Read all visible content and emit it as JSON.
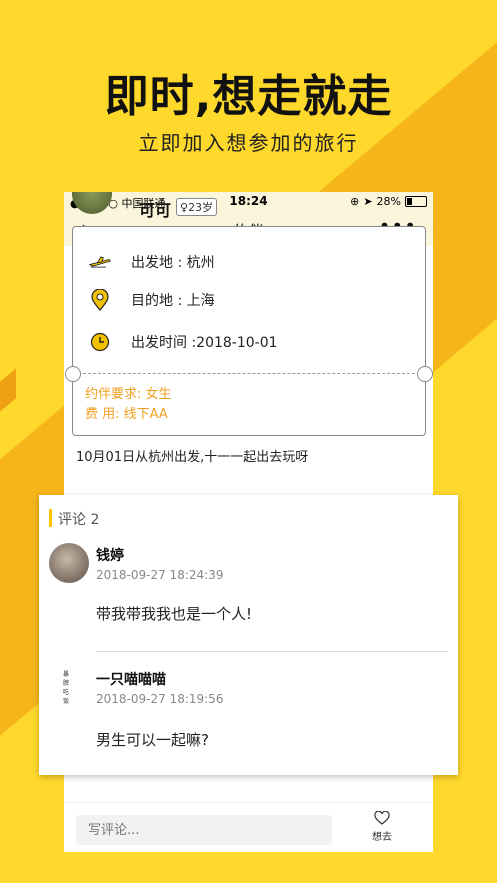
{
  "promo": {
    "headline": "即时,想走就走",
    "subline": "立即加入想参加的旅行"
  },
  "status_bar": {
    "carrier": "●●●●○ 中国联通",
    "time": "18:24",
    "battery": "28%"
  },
  "nav": {
    "title": "约伴",
    "back_icon": "chevron-left-icon",
    "more_icon": "more-dots-icon"
  },
  "owner": {
    "name": "可可",
    "age": "23岁"
  },
  "trip": {
    "departure": "出发地 : 杭州",
    "destination": "目的地 : 上海",
    "depart_time": "出发时间 :2018-10-01",
    "companion_req": "约伴要求: 女生",
    "fee": "费      用: 线下AA",
    "description": "10月01日从杭州出发,十一一起出去玩呀"
  },
  "comments": {
    "header": "评论 2",
    "items": [
      {
        "name": "钱婷",
        "time": "2018-09-27 18:24:39",
        "text": "带我带我我也是一个人!"
      },
      {
        "name": "一只喵喵喵",
        "time": "2018-09-27 18:19:56",
        "text": "男生可以一起嘛?"
      }
    ],
    "avatar2_text": "暴脾吃饭"
  },
  "bottom": {
    "input_placeholder": "写评论...",
    "want_label": "想去"
  },
  "colors": {
    "background": "#ffd82c",
    "accent": "#f0a020"
  }
}
